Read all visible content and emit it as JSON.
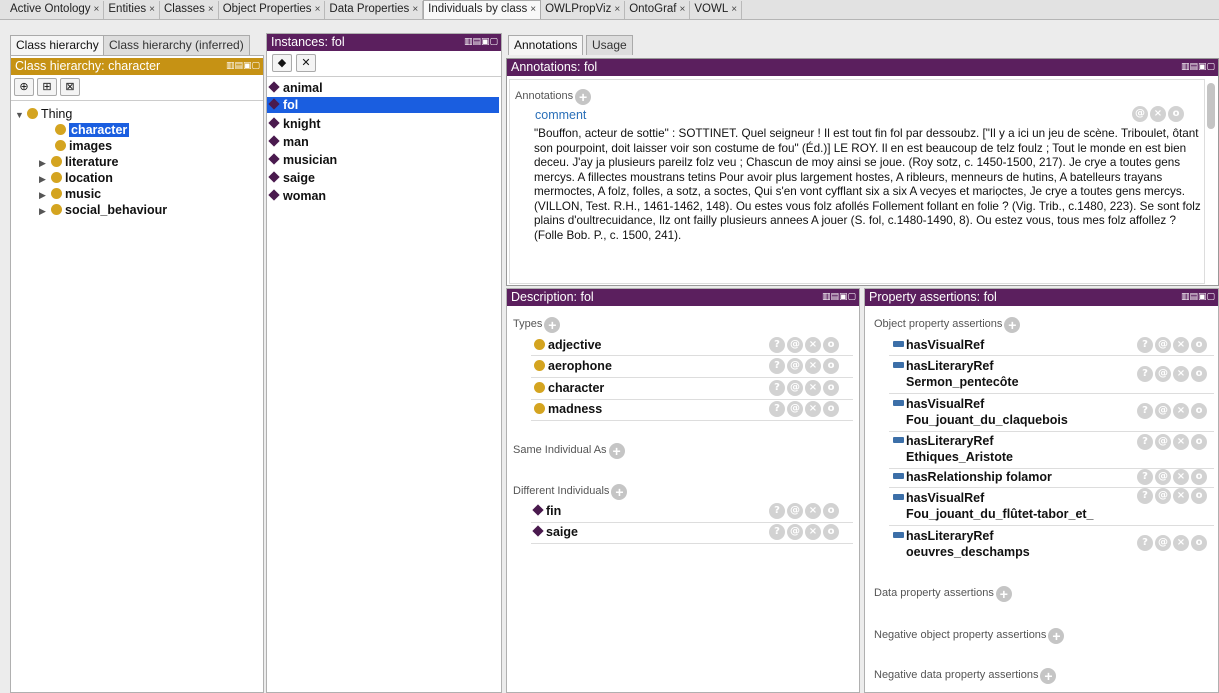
{
  "tabs": [
    {
      "label": "Active Ontology"
    },
    {
      "label": "Entities"
    },
    {
      "label": "Classes"
    },
    {
      "label": "Object Properties"
    },
    {
      "label": "Data Properties"
    },
    {
      "label": "Individuals by class"
    },
    {
      "label": "OWLPropViz"
    },
    {
      "label": "OntoGraf"
    },
    {
      "label": "VOWL"
    }
  ],
  "tab_close": "×",
  "left": {
    "tab_asserted": "Class hierarchy",
    "tab_inferred": "Class hierarchy (inferred)",
    "header": "Class hierarchy: character",
    "tree": {
      "root": "Thing",
      "selected": "character",
      "children": [
        "images",
        "literature",
        "location",
        "music",
        "social_behaviour"
      ]
    }
  },
  "instances": {
    "header": "Instances: fol",
    "items": [
      "animal",
      "fol",
      "knight",
      "man",
      "musician",
      "saige",
      "woman"
    ]
  },
  "right_tabs": {
    "annotations": "Annotations",
    "usage": "Usage"
  },
  "annotations": {
    "header": "Annotations: fol",
    "section": "Annotations",
    "property": "comment",
    "text": "\"Bouffon, acteur de sottie\" : SOTTINET. Quel seigneur ! Il est tout fin fol par dessoubz. [\"Il y a ici un jeu de scène. Triboulet, ôtant son pourpoint, doit laisser voir son costume de fou\" (Éd.)] LE ROY. Il en est beaucoup de telz foulz ; Tout le monde en est bien deceu. J'ay ja plusieurs pareilz folz veu ; Chascun de moy ainsi se joue. (Roy sotz, c. 1450-1500, 217). Je crye a toutes gens mercys. A fillectes moustrans tetins Pour avoir plus largement hostes, A ribleurs, menneurs de hutins, A batelleurs trayans mermoctes, A folz, folles, a sotz, a soctes, Qui s'en vont cyfflant six a six A vecyes et mariọctes, Je crye a toutes gens mercys. (VILLON, Test. R.H., 1461-1462, 148). Ou estes vous folz afollés Follement follant en folie ? (Vig. Trib., c.1480, 223). Se sont folz plains d'oultrecuidance, Ilz ont failly plusieurs annees A jouer (S. fol, c.1480-1490, 8). Ou estez vous, tous mes folz affollez ? (Folle Bob. P., c. 1500, 241)."
  },
  "description": {
    "header": "Description: fol",
    "types_label": "Types",
    "types": [
      "adjective",
      "aerophone",
      "character",
      "madness"
    ],
    "same_label": "Same Individual As",
    "different_label": "Different Individuals",
    "different": [
      "fin",
      "saige"
    ]
  },
  "property_assertions": {
    "header": "Property assertions: fol",
    "object_label": "Object property assertions",
    "object": [
      {
        "prop": "hasVisualRef",
        "value": ""
      },
      {
        "prop": "hasLiteraryRef",
        "value": "Sermon_pentecôte"
      },
      {
        "prop": "hasVisualRef",
        "value": "Fou_jouant_du_claquebois"
      },
      {
        "prop": "hasLiteraryRef",
        "value": "Ethiques_Aristote"
      },
      {
        "prop": "hasRelationship",
        "value": "folamor"
      },
      {
        "prop": "hasVisualRef",
        "value": "Fou_jouant_du_flûtet-tabor_et_"
      },
      {
        "prop": "hasLiteraryRef",
        "value": "oeuvres_deschamps"
      }
    ],
    "data_label": "Data property assertions",
    "neg_object_label": "Negative object property assertions",
    "neg_data_label": "Negative data property assertions"
  },
  "icons": {
    "help": "?",
    "annotate": "@",
    "delete": "×",
    "edit": "o",
    "plus": "+"
  },
  "colors": {
    "header_purple": "#5b1f5e",
    "header_gold": "#c69214",
    "selection": "#1a5ee0"
  }
}
